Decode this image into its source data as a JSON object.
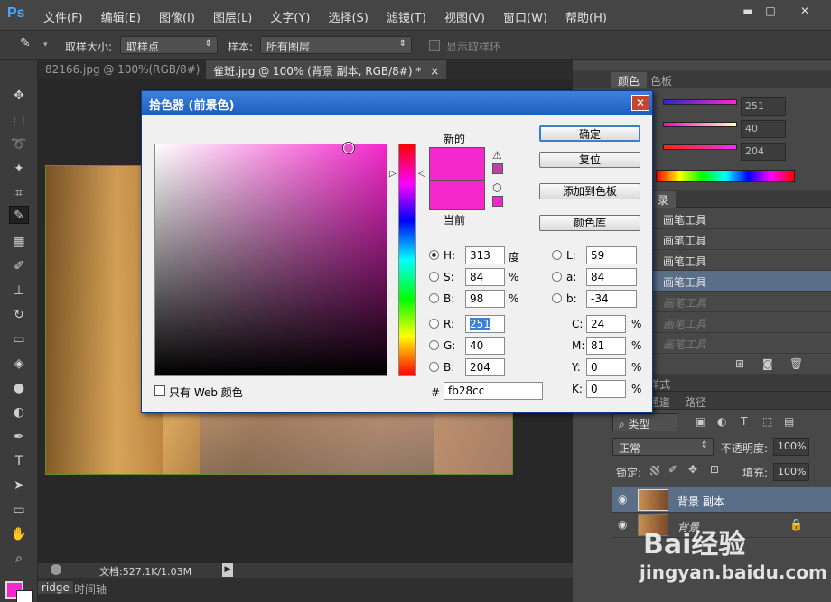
{
  "app": {
    "logo": "Ps"
  },
  "menu": [
    "文件(F)",
    "编辑(E)",
    "图像(I)",
    "图层(L)",
    "文字(Y)",
    "选择(S)",
    "滤镜(T)",
    "视图(V)",
    "窗口(W)",
    "帮助(H)"
  ],
  "window_controls": {
    "minimize": "▬",
    "maximize": "□",
    "close": "✕"
  },
  "options": {
    "sample_size_label": "取样大小:",
    "sample_size_value": "取样点",
    "sample_label": "样本:",
    "sample_value": "所有图层",
    "show_ring_label": "显示取样环"
  },
  "tabs": [
    {
      "label": "82166.jpg @ 100%(RGB/8#)",
      "close": "×"
    },
    {
      "label": "雀斑.jpg @ 100% (背景 副本, RGB/8#) *",
      "close": "×"
    }
  ],
  "status": {
    "doc": "文档:527.1K/1.03M",
    "arrow": "▶"
  },
  "bottom_tabs": [
    "ridge",
    "时间轴"
  ],
  "color_panel": {
    "tabs": [
      "颜色",
      "色板"
    ],
    "values": [
      "251",
      "40",
      "204"
    ]
  },
  "history_panel": {
    "tab": "录",
    "items": [
      "画笔工具",
      "画笔工具",
      "画笔工具",
      "画笔工具",
      "画笔工具",
      "画笔工具",
      "画笔工具"
    ]
  },
  "layers_panel": {
    "tabs_top": "样式",
    "tabs": [
      "通道",
      "路径"
    ],
    "filter_label": "类型",
    "blend_mode": "正常",
    "opacity_label": "不透明度:",
    "opacity_value": "100%",
    "lock_label": "锁定:",
    "fill_label": "填充:",
    "fill_value": "100%",
    "layers": [
      {
        "name": "背景 副本",
        "selected": true
      },
      {
        "name": "背景",
        "selected": false
      }
    ]
  },
  "dialog": {
    "title": "拾色器 (前景色)",
    "close": "✕",
    "new_label": "新的",
    "current_label": "当前",
    "new_color": "#f428cc",
    "current_color": "#f428cc",
    "buttons": {
      "ok": "确定",
      "reset": "复位",
      "add_swatch": "添加到色板",
      "color_lib": "颜色库"
    },
    "hsb": [
      {
        "label": "H:",
        "value": "313",
        "unit": "度",
        "selected": true
      },
      {
        "label": "S:",
        "value": "84",
        "unit": "%",
        "selected": false
      },
      {
        "label": "B:",
        "value": "98",
        "unit": "%",
        "selected": false
      }
    ],
    "rgb": [
      {
        "label": "R:",
        "value": "251"
      },
      {
        "label": "G:",
        "value": "40"
      },
      {
        "label": "B:",
        "value": "204"
      }
    ],
    "lab": [
      {
        "label": "L:",
        "value": "59"
      },
      {
        "label": "a:",
        "value": "84"
      },
      {
        "label": "b:",
        "value": "-34"
      }
    ],
    "cmyk": [
      {
        "label": "C:",
        "value": "24",
        "unit": "%"
      },
      {
        "label": "M:",
        "value": "81",
        "unit": "%"
      },
      {
        "label": "Y:",
        "value": "0",
        "unit": "%"
      },
      {
        "label": "K:",
        "value": "0",
        "unit": "%"
      }
    ],
    "hex_label": "#",
    "hex_value": "fb28cc",
    "web_only_label": "只有 Web 颜色"
  },
  "watermark": {
    "brand": "Bai经验",
    "url": "jingyan.baidu.com"
  },
  "colors": {
    "foreground": "#f428cc",
    "accent": "#3c82dc"
  }
}
